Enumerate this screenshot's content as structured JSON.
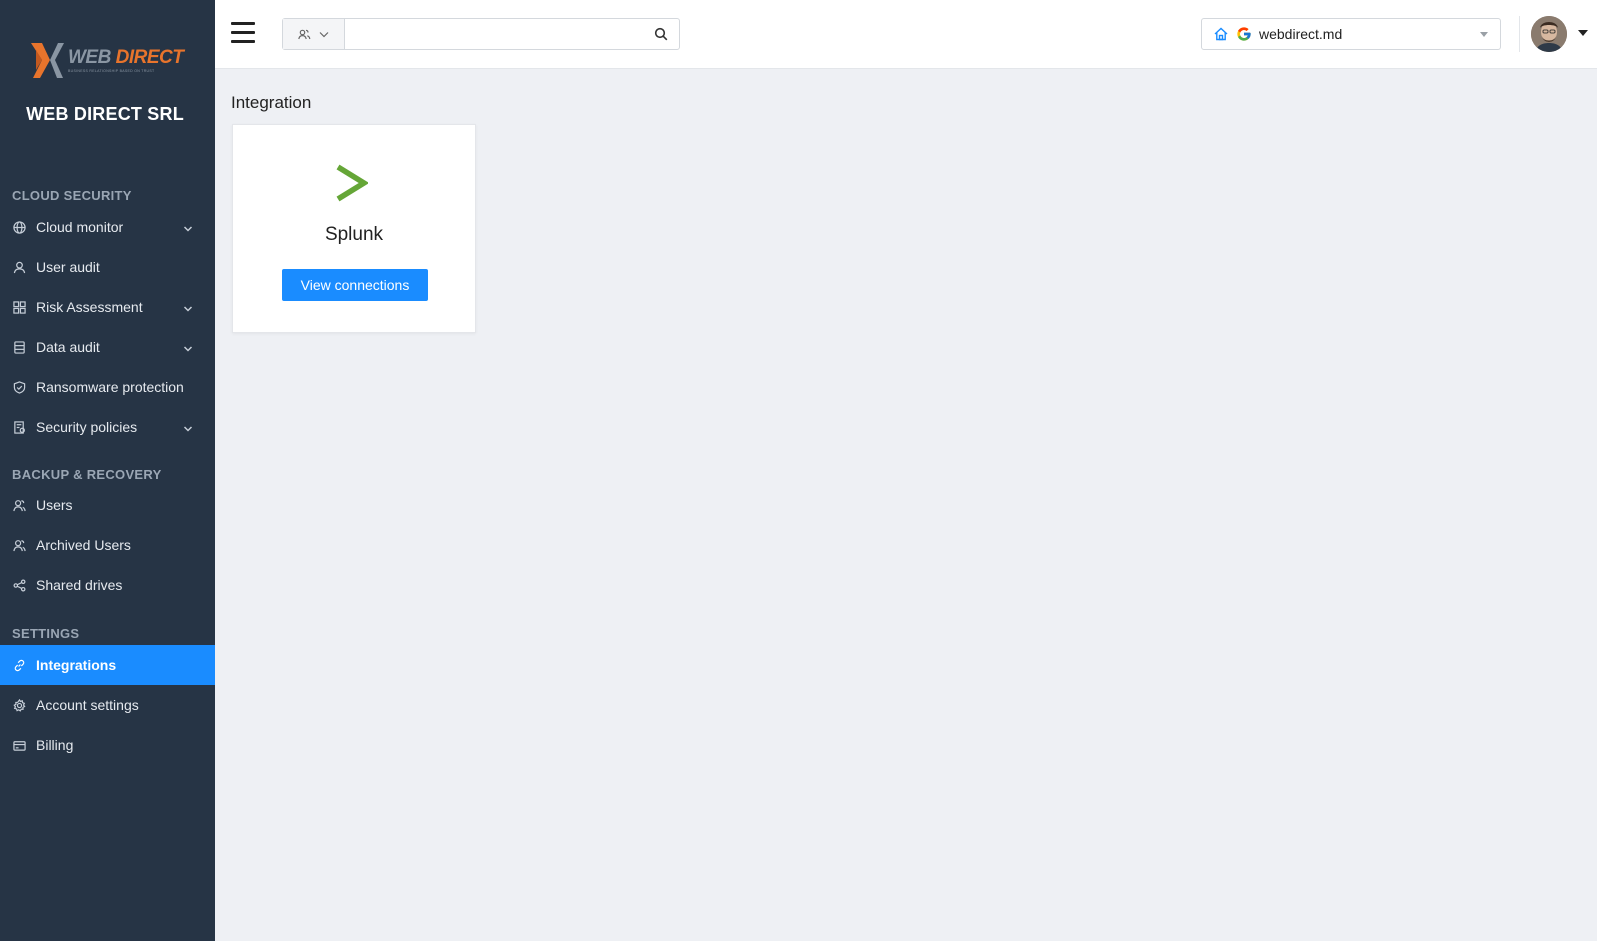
{
  "brand": {
    "logo_word_1": "WEB",
    "logo_word_2": "DIRECT",
    "logo_tagline": "BUSINESS RELATIONSHIP BASED ON TRUST",
    "company_name": "WEB DIRECT SRL"
  },
  "sidebar": {
    "sections": [
      {
        "title": "CLOUD SECURITY",
        "items": [
          {
            "label": "Cloud monitor",
            "icon": "globe-icon",
            "has_submenu": true
          },
          {
            "label": "User audit",
            "icon": "user-icon",
            "has_submenu": false
          },
          {
            "label": "Risk Assessment",
            "icon": "grid-icon",
            "has_submenu": true
          },
          {
            "label": "Data audit",
            "icon": "database-icon",
            "has_submenu": true
          },
          {
            "label": "Ransomware protection",
            "icon": "shield-icon",
            "has_submenu": false
          },
          {
            "label": "Security policies",
            "icon": "policy-icon",
            "has_submenu": true
          }
        ]
      },
      {
        "title": "BACKUP & RECOVERY",
        "items": [
          {
            "label": "Users",
            "icon": "users-icon"
          },
          {
            "label": "Archived Users",
            "icon": "archived-users-icon"
          },
          {
            "label": "Shared drives",
            "icon": "share-icon"
          }
        ]
      },
      {
        "title": "SETTINGS",
        "items": [
          {
            "label": "Integrations",
            "icon": "link-icon",
            "active": true
          },
          {
            "label": "Account settings",
            "icon": "gear-icon"
          },
          {
            "label": "Billing",
            "icon": "credit-card-icon"
          }
        ]
      }
    ]
  },
  "header": {
    "search": {
      "value": "",
      "placeholder": ""
    },
    "domain_selector": {
      "value": "webdirect.md"
    }
  },
  "main": {
    "title": "Integration",
    "integrations": [
      {
        "name": "Splunk",
        "button_label": "View connections",
        "logo_color": "#65a637"
      }
    ]
  },
  "colors": {
    "sidebar_bg": "#263445",
    "accent": "#1a8cff",
    "page_bg": "#eef0f4"
  }
}
